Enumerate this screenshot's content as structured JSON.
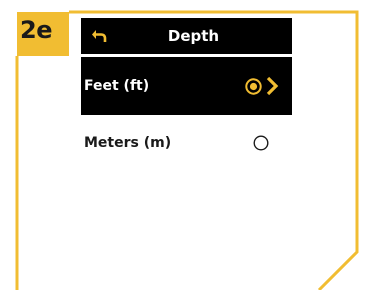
{
  "step": {
    "label": "2e"
  },
  "header": {
    "title": "Depth",
    "back_icon": "back-arrow-icon"
  },
  "options": [
    {
      "label": "Feet (ft)",
      "selected": true,
      "indicator_icon": "radio-selected-icon",
      "chevron_icon": "chevron-right-icon"
    },
    {
      "label": "Meters (m)",
      "selected": false,
      "indicator_icon": "radio-unselected-icon"
    }
  ],
  "colors": {
    "accent": "#f1bd32",
    "selected_row_bg": "#000000",
    "header_bg": "#000000",
    "selected_text": "#ffffff",
    "text": "#1a1a1a",
    "background": "#ffffff"
  }
}
